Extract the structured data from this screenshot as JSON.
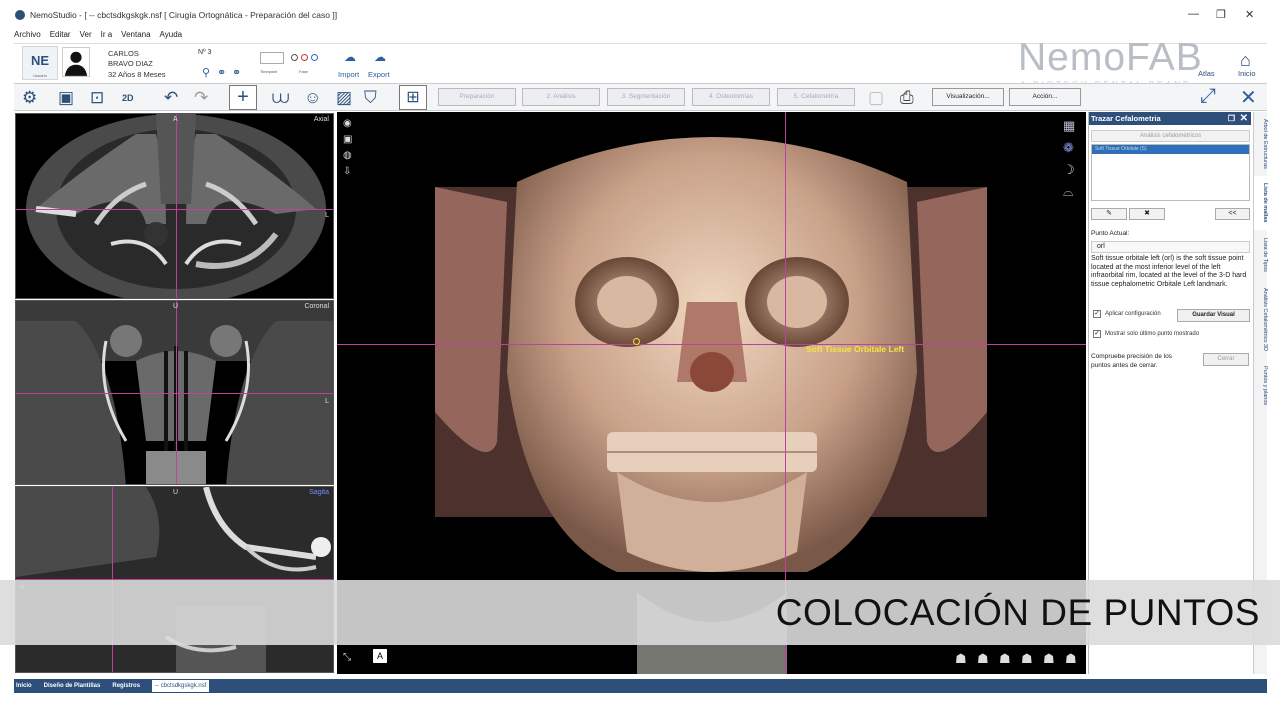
{
  "window": {
    "title": "NemoStudio - [ -- cbctsdkgskgk.nsf [ Cirugía Ortognática - Preparación del caso ]]",
    "controls": [
      "—",
      "❐",
      "✕"
    ]
  },
  "menu": [
    "Archivo",
    "Editar",
    "Ver",
    "Ir a",
    "Ventana",
    "Ayuda"
  ],
  "patient": {
    "logo": "NE",
    "logo_sub": "Usuario",
    "first_name": "CARLOS",
    "last_name": "BRAVO DIAZ",
    "age": "32 Años 8 Meses",
    "number": "Nº 3",
    "timepoint_label": "Timepoint",
    "phase_label": "Fase",
    "import_label": "Import",
    "export_label": "Export"
  },
  "brand": {
    "name": "NemoFAB",
    "tagline": "A BIOTECH DENTAL BRAND",
    "atlas_label": "Atlas",
    "home_label": "Inicio"
  },
  "toolbar": {
    "view2d_label": "2D",
    "steps": [
      {
        "label": "Preparación",
        "active": false
      },
      {
        "label": "2. Análisis",
        "active": false
      },
      {
        "label": "3. Segmentación",
        "active": false
      },
      {
        "label": "4. Osteotomías",
        "active": false
      },
      {
        "label": "5. Cefalometría",
        "active": false
      }
    ],
    "visualizacion_label": "Visualización...",
    "accion_label": "Acción..."
  },
  "slices": {
    "axial": {
      "label": "Axial",
      "top": "A",
      "right": "L"
    },
    "coronal": {
      "label": "Coronal",
      "top": "U",
      "right": "L"
    },
    "sagittal": {
      "label": "Sagita",
      "top": "U",
      "left": "A"
    }
  },
  "view3d": {
    "landmark_label": "Soft Tissue Orbitale Left",
    "bottom_letter": "A"
  },
  "right_panel": {
    "title": "Trazar Cefalometria",
    "tab_button": "Análisis cefalométricos",
    "selected_item": "Soft Tissue Orbitale (S)",
    "back_button": "<<",
    "punto_actual_label": "Punto Actual:",
    "punto_actual_value": "orl",
    "description": "Soft tissue orbitale left (orl) is the soft tissue point located at the most inferior level of the left infraorbital rim, located at the level of the 3-D hard tissue cephalometric Orbitale Left landmark.",
    "apply_config_label": "Aplicar configuración",
    "save_visual_button": "Guardar Visual",
    "show_last_label": "Mostrar solo último punto mostrado",
    "check_precision_label": "Compruebe precisión de los puntos antes de cerrar.",
    "close_button": "Cerrar"
  },
  "vertical_tabs": [
    {
      "label": "Árbol de Estructuras",
      "active": false
    },
    {
      "label": "Lista de mallas",
      "active": true
    },
    {
      "label": "Lista de Tipos",
      "active": false
    },
    {
      "label": "Análisis Cefalométrico 3D",
      "active": false
    },
    {
      "label": "Puntos y planos",
      "active": false
    }
  ],
  "caption": "COLOCACIÓN DE PUNTOS",
  "statusbar": [
    {
      "label": "Inicio",
      "active": false
    },
    {
      "label": "Diseño de Plantillas",
      "active": false
    },
    {
      "label": "Registros",
      "active": false
    },
    {
      "label": "-- cbctsdkgskgk.nsf",
      "active": true
    }
  ],
  "colors": {
    "primary": "#2d4f7a",
    "crosshair": "#c040a0",
    "landmark": "#f4e53a",
    "bone": "#d8b8a0"
  }
}
